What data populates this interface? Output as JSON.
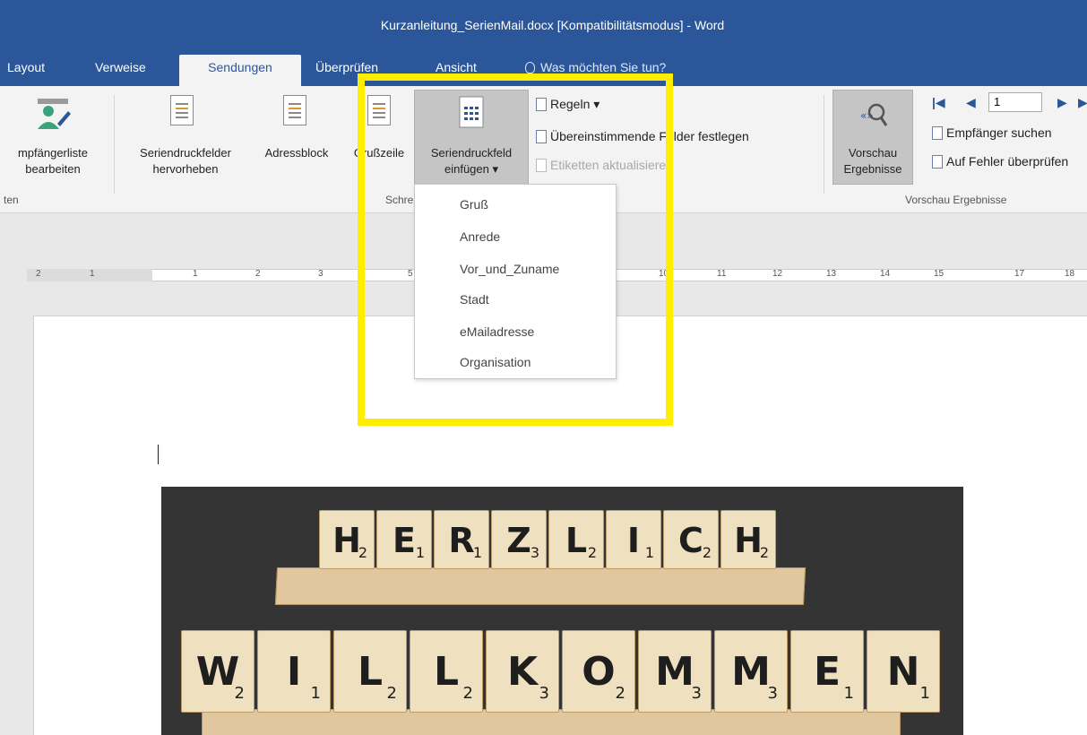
{
  "window": {
    "title": "Kurzanleitung_SerienMail.docx [Kompatibilitätsmodus] - Word"
  },
  "tabs": [
    {
      "label": "Layout"
    },
    {
      "label": "Verweise"
    },
    {
      "label": "Sendungen",
      "active": true
    },
    {
      "label": "Überprüfen"
    },
    {
      "label": "Ansicht"
    }
  ],
  "tell_me": {
    "placeholder": "Was möchten Sie tun?"
  },
  "ribbon": {
    "edit_recipients": {
      "line1": "mpfängerliste",
      "line2": "bearbeiten"
    },
    "group_left_label": "ten",
    "highlight_fields": {
      "line1": "Seriendruckfelder",
      "line2": "hervorheben"
    },
    "address_block": "Adressblock",
    "greeting_line": "Grußzeile",
    "insert_field": {
      "line1": "Seriendruckfeld",
      "line2": "einfügen ▾"
    },
    "rules": "Regeln ▾",
    "match_fields": "Übereinstimmende Felder festlegen",
    "update_labels": "Etiketten aktualisieren",
    "group_write_label": "Schreiben und Felder einfügen",
    "preview": {
      "line1": "Vorschau",
      "line2": "Ergebnisse"
    },
    "record_number": "1",
    "find_recipient": "Empfänger suchen",
    "check_errors": "Auf Fehler überprüfen",
    "group_preview_label": "Vorschau Ergebnisse"
  },
  "dropdown": {
    "items": [
      "Gruß",
      "Anrede",
      "Vor_und_Zuname",
      "Stadt",
      "eMailadresse",
      "Organisation"
    ]
  },
  "ruler": {
    "ticks": [
      "2",
      "1",
      "1",
      "2",
      "3",
      "5",
      "10",
      "11",
      "12",
      "13",
      "14",
      "15",
      "17",
      "18"
    ]
  },
  "photo": {
    "row1": [
      {
        "letter": "H",
        "value": "2"
      },
      {
        "letter": "E",
        "value": "1"
      },
      {
        "letter": "R",
        "value": "1"
      },
      {
        "letter": "Z",
        "value": "3"
      },
      {
        "letter": "L",
        "value": "2"
      },
      {
        "letter": "I",
        "value": "1"
      },
      {
        "letter": "C",
        "value": "2"
      },
      {
        "letter": "H",
        "value": "2"
      }
    ],
    "row2": [
      {
        "letter": "W",
        "value": "2"
      },
      {
        "letter": "I",
        "value": "1"
      },
      {
        "letter": "L",
        "value": "2"
      },
      {
        "letter": "L",
        "value": "2"
      },
      {
        "letter": "K",
        "value": "3"
      },
      {
        "letter": "O",
        "value": "2"
      },
      {
        "letter": "M",
        "value": "3"
      },
      {
        "letter": "M",
        "value": "3"
      },
      {
        "letter": "E",
        "value": "1"
      },
      {
        "letter": "N",
        "value": "1"
      }
    ]
  },
  "colors": {
    "word_blue": "#2b579a",
    "highlight": "#ffee00",
    "ribbon_bg": "#f3f3f3"
  }
}
